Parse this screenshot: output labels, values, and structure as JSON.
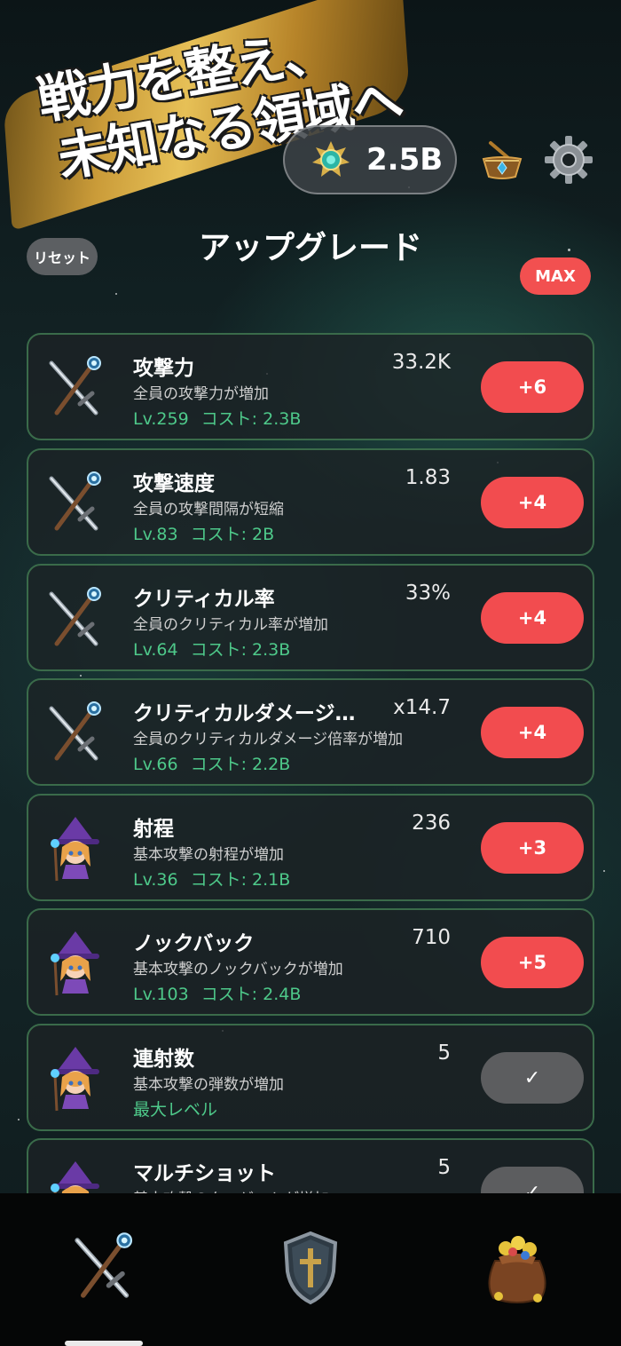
{
  "banner": {
    "line1": "戦力を整え、",
    "line2": "未知なる領域へ"
  },
  "header": {
    "currency_value": "2.5B"
  },
  "toolbar": {
    "reset_label": "リセット",
    "title": "アップグレード",
    "max_label": "MAX"
  },
  "upgrades": [
    {
      "name": "攻撃力",
      "value": "33.2K",
      "desc": "全員の攻撃力が増加",
      "level": "Lv.259",
      "cost": "コスト: 2.3B",
      "button": "+6",
      "icon": "sword-staff-icon"
    },
    {
      "name": "攻撃速度",
      "value": "1.83",
      "desc": "全員の攻撃間隔が短縮",
      "level": "Lv.83",
      "cost": "コスト: 2B",
      "button": "+4",
      "icon": "sword-staff-icon"
    },
    {
      "name": "クリティカル率",
      "value": "33%",
      "desc": "全員のクリティカル率が増加",
      "level": "Lv.64",
      "cost": "コスト: 2.3B",
      "button": "+4",
      "icon": "sword-staff-icon"
    },
    {
      "name": "クリティカルダメージ…",
      "value": "x14.7",
      "desc": "全員のクリティカルダメージ倍率が増加",
      "level": "Lv.66",
      "cost": "コスト: 2.2B",
      "button": "+4",
      "icon": "sword-staff-icon"
    },
    {
      "name": "射程",
      "value": "236",
      "desc": "基本攻撃の射程が増加",
      "level": "Lv.36",
      "cost": "コスト: 2.1B",
      "button": "+3",
      "icon": "witch-icon"
    },
    {
      "name": "ノックバック",
      "value": "710",
      "desc": "基本攻撃のノックバックが増加",
      "level": "Lv.103",
      "cost": "コスト: 2.4B",
      "button": "+5",
      "icon": "witch-icon"
    },
    {
      "name": "連射数",
      "value": "5",
      "desc": "基本攻撃の弾数が増加",
      "level": "最大レベル",
      "cost": "",
      "button": "✓",
      "icon": "witch-icon"
    },
    {
      "name": "マルチショット",
      "value": "5",
      "desc": "基本攻撃のターゲットが増加",
      "level": "",
      "cost": "",
      "button": "✓",
      "icon": "witch-icon"
    }
  ],
  "nav": {
    "tabs": [
      "sword-staff-icon",
      "shield-icon",
      "treasure-bag-icon"
    ]
  },
  "colors": {
    "accent_red": "#f24c4f",
    "level_green": "#4ec98a",
    "card_border": "#3a6b4a"
  }
}
